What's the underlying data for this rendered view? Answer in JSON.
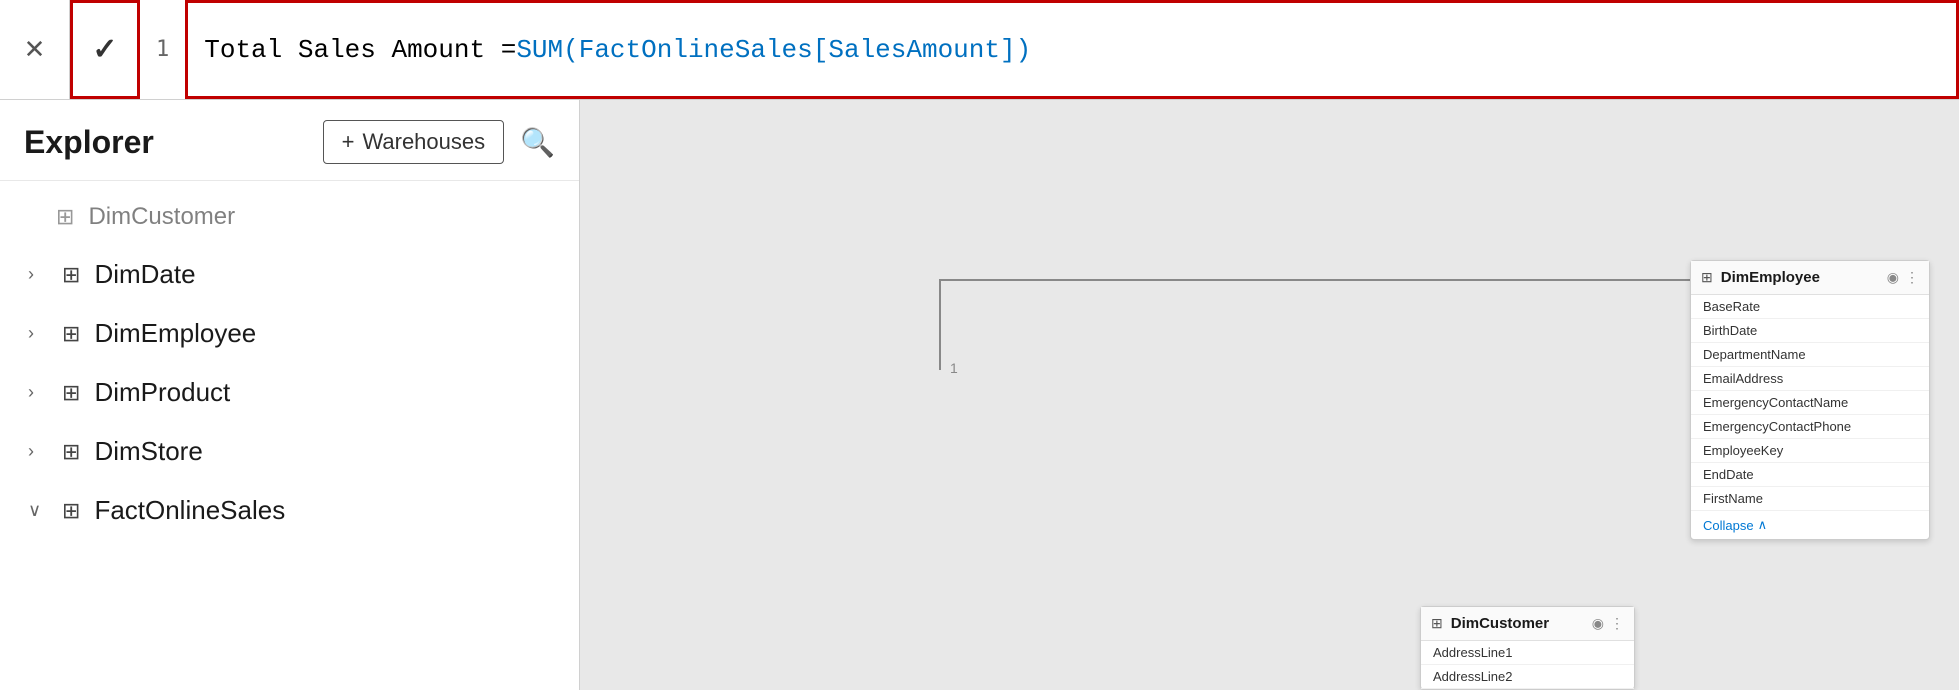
{
  "formulaBar": {
    "cancelLabel": "✕",
    "confirmLabel": "✓",
    "lineNumber": "1",
    "formulaBlack": "Total Sales Amount = ",
    "formulaBlue": "SUM(FactOnlineSales[SalesAmount])"
  },
  "sidebar": {
    "title": "Explorer",
    "addWarehouseLabel": "Warehouses",
    "addIcon": "+",
    "searchIcon": "⌕",
    "items": [
      {
        "id": "dimcustomer-partial",
        "label": "DimCustomer",
        "chevron": "",
        "partial": true
      },
      {
        "id": "dimdate",
        "label": "DimDate",
        "chevron": "›",
        "expanded": false
      },
      {
        "id": "dimemployee",
        "label": "DimEmployee",
        "chevron": "›",
        "expanded": false
      },
      {
        "id": "dimproduct",
        "label": "DimProduct",
        "chevron": "›",
        "expanded": false
      },
      {
        "id": "dimstore",
        "label": "DimStore",
        "chevron": "›",
        "expanded": false
      },
      {
        "id": "factonlinesales",
        "label": "FactOnlineSales",
        "chevron": "∨",
        "expanded": true
      }
    ]
  },
  "dimEmployeeCard": {
    "title": "DimEmployee",
    "fields": [
      "BaseRate",
      "BirthDate",
      "DepartmentName",
      "EmailAddress",
      "EmergencyContactName",
      "EmergencyContactPhone",
      "EmployeeKey",
      "EndDate",
      "FirstName"
    ],
    "collapseLabel": "Collapse",
    "collapseIcon": "∧"
  },
  "dimCustomerCard": {
    "title": "DimCustomer",
    "fields": [
      "AddressLine1",
      "AddressLine2"
    ]
  },
  "icons": {
    "tableIcon": "⊞",
    "eyeIcon": "◉",
    "moreIcon": "⋮"
  }
}
